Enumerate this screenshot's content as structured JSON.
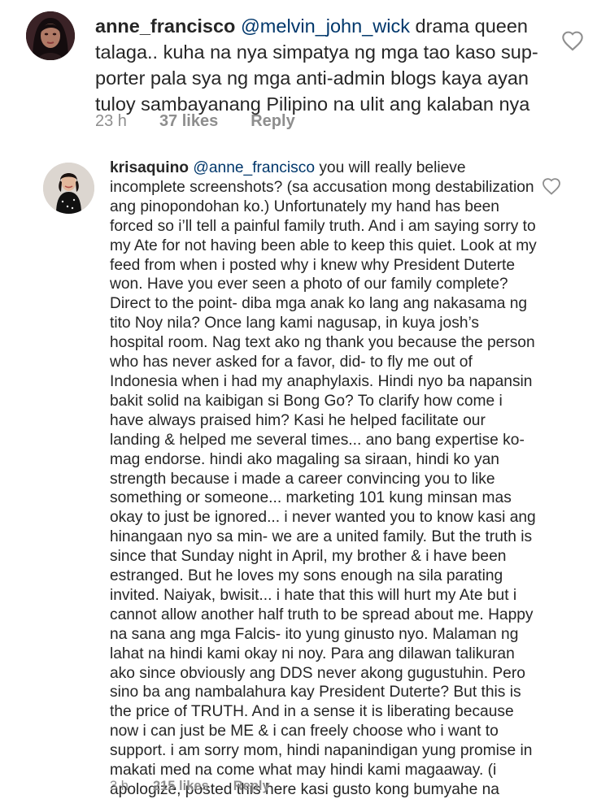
{
  "comments": [
    {
      "username": "anne_francisco",
      "mention": "@melvin_john_wick",
      "body": " drama queen talaga.. kuha na nya simpatya ng mga tao kaso sup-porter pala sya ng mga anti-admin blogs kaya ayan tuloy sambayanang Pilipino na ulit ang kalaban nya",
      "time": "23 h",
      "likes": "37 likes",
      "reply": "Reply"
    },
    {
      "username": "krisaquino",
      "mention": "@anne_francisco",
      "body": " you will really believe incomplete screenshots? (sa accusation mong destabilization ang pinopondohan ko.) Unfortunately my hand has been forced so i’ll tell a painful family truth. And i am saying sorry to my Ate for not having been able to keep this quiet. Look at my feed from when i posted why i knew why President Duterte won. Have you ever seen a photo of our family complete? Direct to the point- diba mga anak ko lang ang nakasama ng tito Noy nila? Once lang kami nagusap, in kuya josh’s hospital room. Nag text ako ng thank you because the person who has never asked for a favor, did- to fly me out of Indonesia when i had my anaphylaxis. Hindi nyo ba napansin bakit solid na kaibigan si Bong Go? To clarify how come i have always praised him? Kasi he helped facilitate our landing & helped me several times... ano bang expertise ko- mag endorse. hindi ako magaling sa siraan, hindi ko yan strength because i made a career convincing you to like something or someone... marketing 101 kung minsan mas okay to just be ignored... i never wanted you to know kasi ang hinangaan nyo sa min- we are a united family. But the truth is since that Sunday night in April, my brother & i have been estranged. But he loves my sons enough na sila parating invited. Naiyak, bwisit... i hate that this will hurt my Ate but i cannot allow another half truth to be spread about me. Happy na sana ang mga Falcis- ito yung ginusto nyo. Malaman ng lahat na hindi kami okay ni noy. Para ang dilawan talikuran ako since obviously ang DDS never akong gugustuhin. Pero sino ba ang nambalahura kay President Duterte? But this is the price of TRUTH. And in a sense it is liberating because now i can just be ME & i can freely choose who i want to support. i am sorry mom, hindi napanindigan yung promise in makati med na come what may hindi kami magaaway. (i apologize, posted this here kasi gusto kong bumyahe na walang tinago sa inyo.)",
      "time": "3 h",
      "likes": "215 likes",
      "reply": "Reply"
    }
  ]
}
